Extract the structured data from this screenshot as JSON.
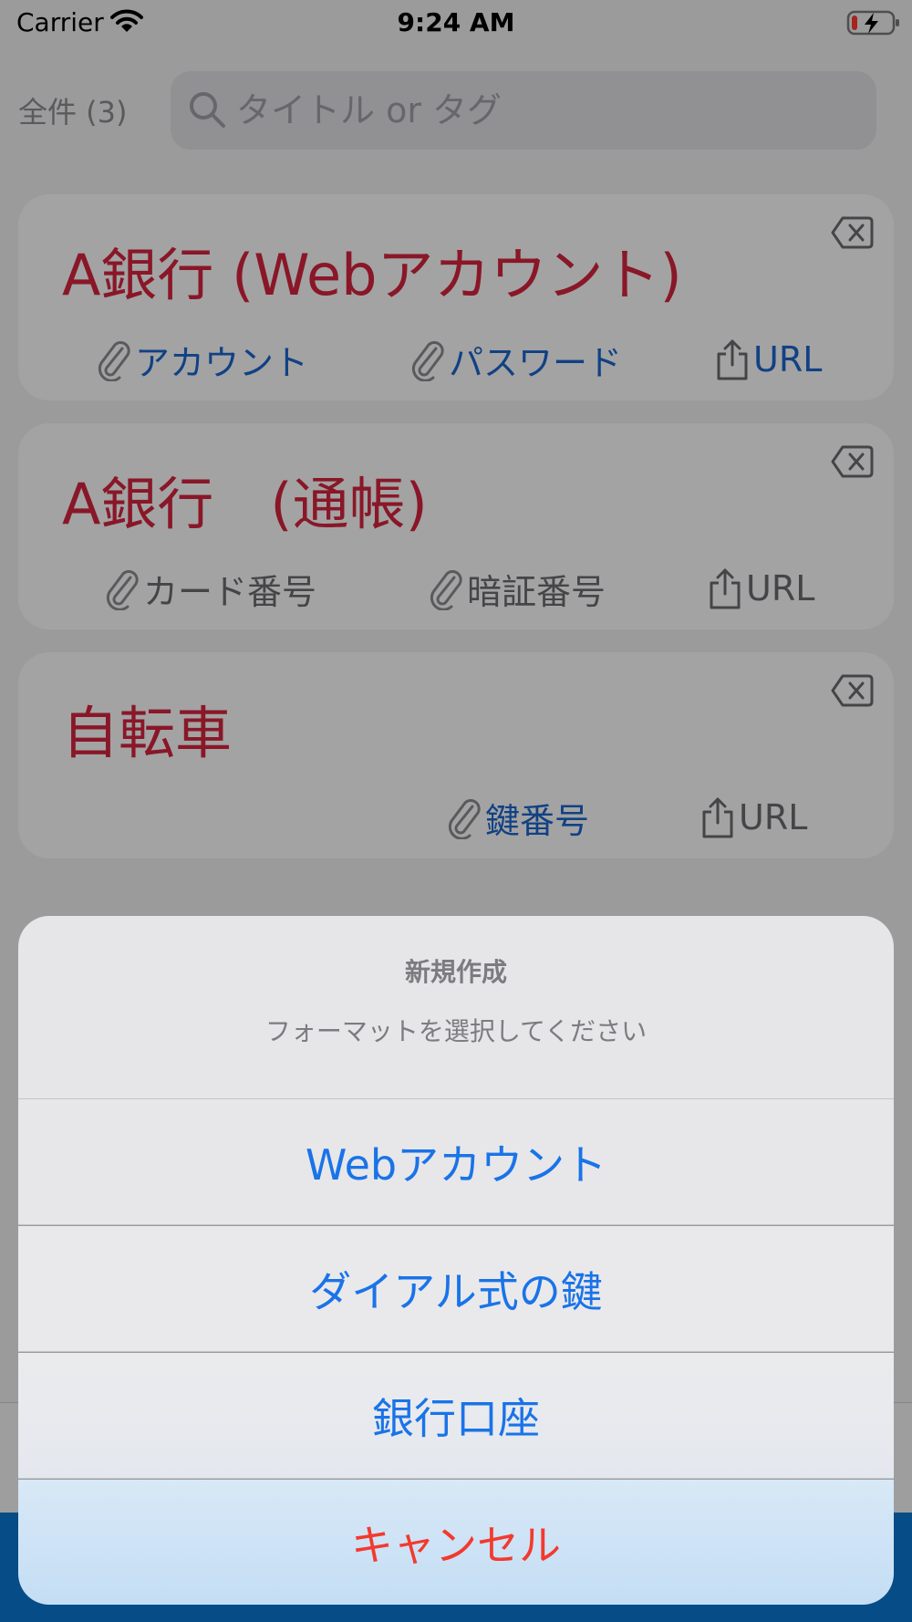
{
  "status_bar": {
    "carrier": "Carrier",
    "time": "9:24 AM"
  },
  "header": {
    "count_label": "全件 (3)",
    "search_placeholder": "タイトル or タグ"
  },
  "cards": [
    {
      "title": "A銀行 (Webアカウント)",
      "links": [
        {
          "label": "アカウント",
          "icon": "paperclip-icon"
        },
        {
          "label": "パスワード",
          "icon": "paperclip-icon"
        },
        {
          "label": "URL",
          "icon": "share-icon"
        }
      ]
    },
    {
      "title": "A銀行　(通帳)",
      "links": [
        {
          "label": "カード番号",
          "icon": "paperclip-icon"
        },
        {
          "label": "暗証番号",
          "icon": "paperclip-icon"
        },
        {
          "label": "URL",
          "icon": "share-icon"
        }
      ]
    },
    {
      "title": "自転車",
      "links": [
        {
          "label": "鍵番号",
          "icon": "paperclip-icon"
        },
        {
          "label": "URL",
          "icon": "share-icon"
        }
      ]
    }
  ],
  "action_sheet": {
    "title": "新規作成",
    "message": "フォーマットを選択してください",
    "actions": [
      "Webアカウント",
      "ダイアル式の鍵",
      "銀行口座"
    ],
    "cancel": "キャンセル"
  },
  "colors": {
    "title_red": "#d7243f",
    "link_blue": "#1b66cf",
    "action_blue": "#1a73e8",
    "cancel_red": "#f23a2e"
  }
}
